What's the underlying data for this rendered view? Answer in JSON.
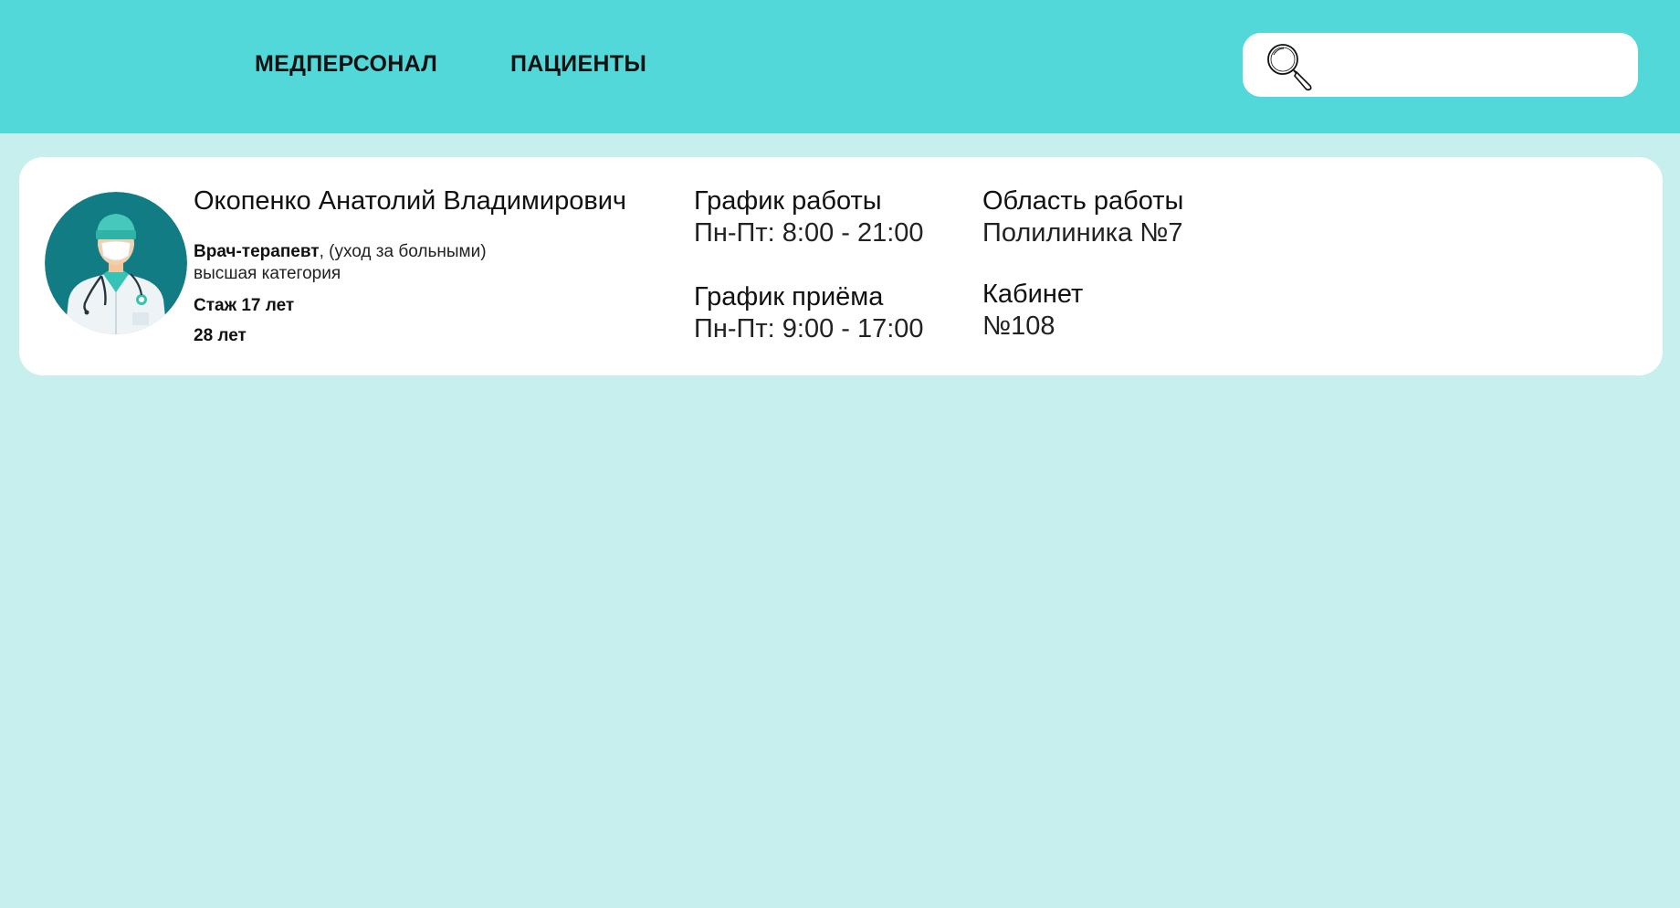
{
  "nav": {
    "staff_label": "МЕДПЕРСОНАЛ",
    "patients_label": "ПАЦИЕНТЫ"
  },
  "search": {
    "icon": "search-icon",
    "value": "",
    "placeholder": ""
  },
  "doctor": {
    "avatar_icon": "doctor-avatar",
    "name": "Окопенко Анатолий Владимирович",
    "specialty": "Врач-терапевт",
    "specialty_note": ", (уход за больными)",
    "category": "высшая категория",
    "experience": "Стаж 17 лет",
    "age": "28 лет",
    "work_schedule_label": "График работы",
    "work_schedule_value": "Пн-Пт: 8:00 - 21:00",
    "reception_schedule_label": "График приёма",
    "reception_schedule_value": "Пн-Пт: 9:00 - 17:00",
    "work_area_label": "Область работы",
    "work_area_value": "Полилиника №7",
    "room_label": "Кабинет",
    "room_value": "№108"
  },
  "colors": {
    "header": "#52d8d8",
    "background": "#c7efed",
    "card": "#ffffff",
    "avatar_bg": "#127c85"
  }
}
